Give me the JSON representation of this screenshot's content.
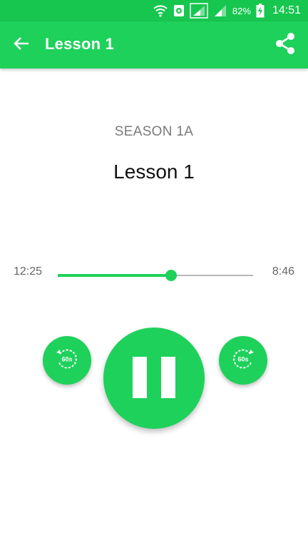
{
  "status_bar": {
    "battery_percent": "82%",
    "time": "14:51",
    "icons": [
      "wifi-icon",
      "notification-app-icon",
      "signal-icon",
      "signal-icon",
      "battery-charging-icon"
    ]
  },
  "app_bar": {
    "title": "Lesson 1",
    "back_icon": "arrow-back-icon",
    "share_icon": "share-icon"
  },
  "content": {
    "season": "SEASON 1A",
    "lesson": "Lesson 1"
  },
  "player": {
    "elapsed": "12:25",
    "total": "8:46",
    "progress": 0.58,
    "rewind_label": "60s",
    "forward_label": "60s",
    "state": "playing"
  },
  "colors": {
    "status_bar": "#17c64f",
    "accent": "#1ed15b",
    "track": "#b8b8b8",
    "muted_text": "#7a7a7a"
  }
}
